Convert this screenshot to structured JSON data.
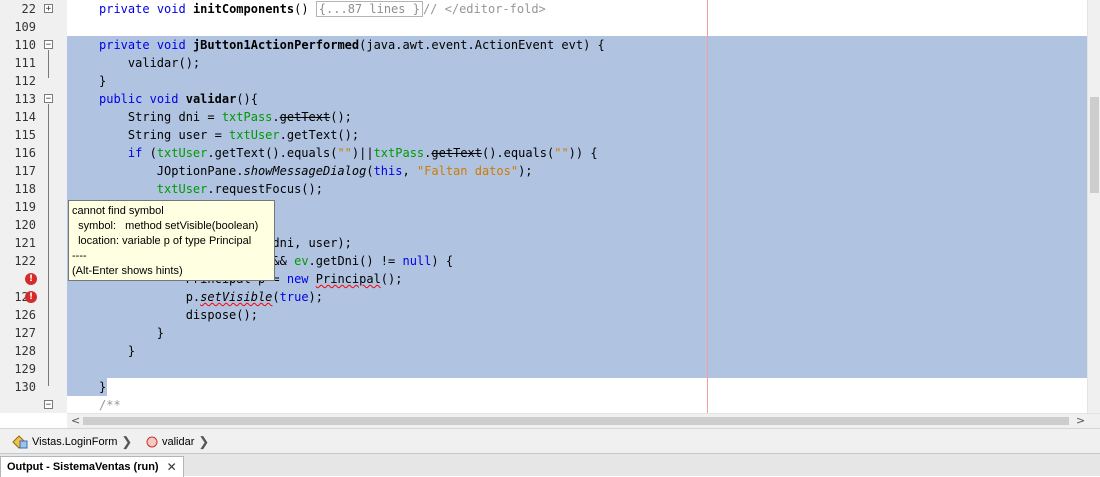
{
  "editor": {
    "gutter": {
      "line_numbers": [
        "22",
        "109",
        "110",
        "111",
        "112",
        "113",
        "114",
        "115",
        "116",
        "117",
        "118",
        "119",
        "120",
        "121",
        "122",
        "",
        "",
        "125",
        "126",
        "127",
        "128",
        "129",
        "130"
      ],
      "fold_markers": {
        "22": "+",
        "110": "−",
        "113": "−",
        "130": "−"
      },
      "error_icon": "error-icon"
    },
    "tooltip": {
      "line1": "cannot find symbol",
      "line2": "  symbol:   method setVisible(boolean)",
      "line3": "  location: variable p of type Principal",
      "line4": "----",
      "line5": "(Alt-Enter shows hints)"
    },
    "colors": {
      "selection": "#b0c4e2",
      "keyword": "#0000e6",
      "field": "#009900",
      "string": "#ce7b00",
      "error": "#d52b2b"
    }
  },
  "breadcrumb": {
    "item1": "Vistas.LoginForm",
    "item2": "validar"
  },
  "output": {
    "tab_label": "Output - SistemaVentas (run)",
    "close": "✕"
  },
  "scroll": {
    "left_arrow": "<",
    "right_arrow": ">"
  }
}
